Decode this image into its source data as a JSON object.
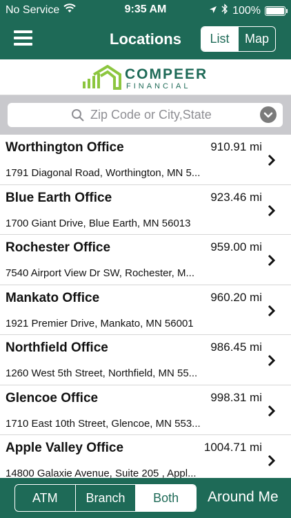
{
  "status_bar": {
    "carrier": "No Service",
    "time": "9:35 AM",
    "battery": "100%",
    "battery_level_percent": 100
  },
  "nav": {
    "title": "Locations",
    "list_label": "List",
    "map_label": "Map",
    "selected": "List"
  },
  "logo": {
    "line1": "COMPEER",
    "line2": "FINANCIAL"
  },
  "search": {
    "placeholder": "Zip Code or City,State",
    "value": ""
  },
  "locations": [
    {
      "name": "Worthington Office",
      "distance": "910.91 mi",
      "address": "1791 Diagonal Road, Worthington, MN 5..."
    },
    {
      "name": "Blue Earth Office",
      "distance": "923.46 mi",
      "address": "1700 Giant Drive, Blue Earth, MN 56013"
    },
    {
      "name": "Rochester Office",
      "distance": "959.00 mi",
      "address": "7540 Airport View Dr SW, Rochester, M..."
    },
    {
      "name": "Mankato Office",
      "distance": "960.20 mi",
      "address": "1921 Premier Drive, Mankato, MN 56001"
    },
    {
      "name": "Northfield Office",
      "distance": "986.45 mi",
      "address": "1260 West 5th Street, Northfield, MN 55..."
    },
    {
      "name": "Glencoe Office",
      "distance": "998.31 mi",
      "address": "1710 East 10th Street, Glencoe, MN 553..."
    },
    {
      "name": "Apple Valley Office",
      "distance": "1004.71 mi",
      "address": "14800 Galaxie Avenue, Suite 205 , Appl..."
    }
  ],
  "filter": {
    "atm_label": "ATM",
    "branch_label": "Branch",
    "both_label": "Both",
    "selected": "Both"
  },
  "around_me_label": "Around Me",
  "colors": {
    "brand_teal": "#1e6a57",
    "logo_green": "#8cc63f"
  },
  "icons": [
    "wifi-icon",
    "location-arrow-icon",
    "bluetooth-icon",
    "battery-icon",
    "menu-icon",
    "search-icon",
    "chevron-down-icon",
    "chevron-right-icon"
  ]
}
